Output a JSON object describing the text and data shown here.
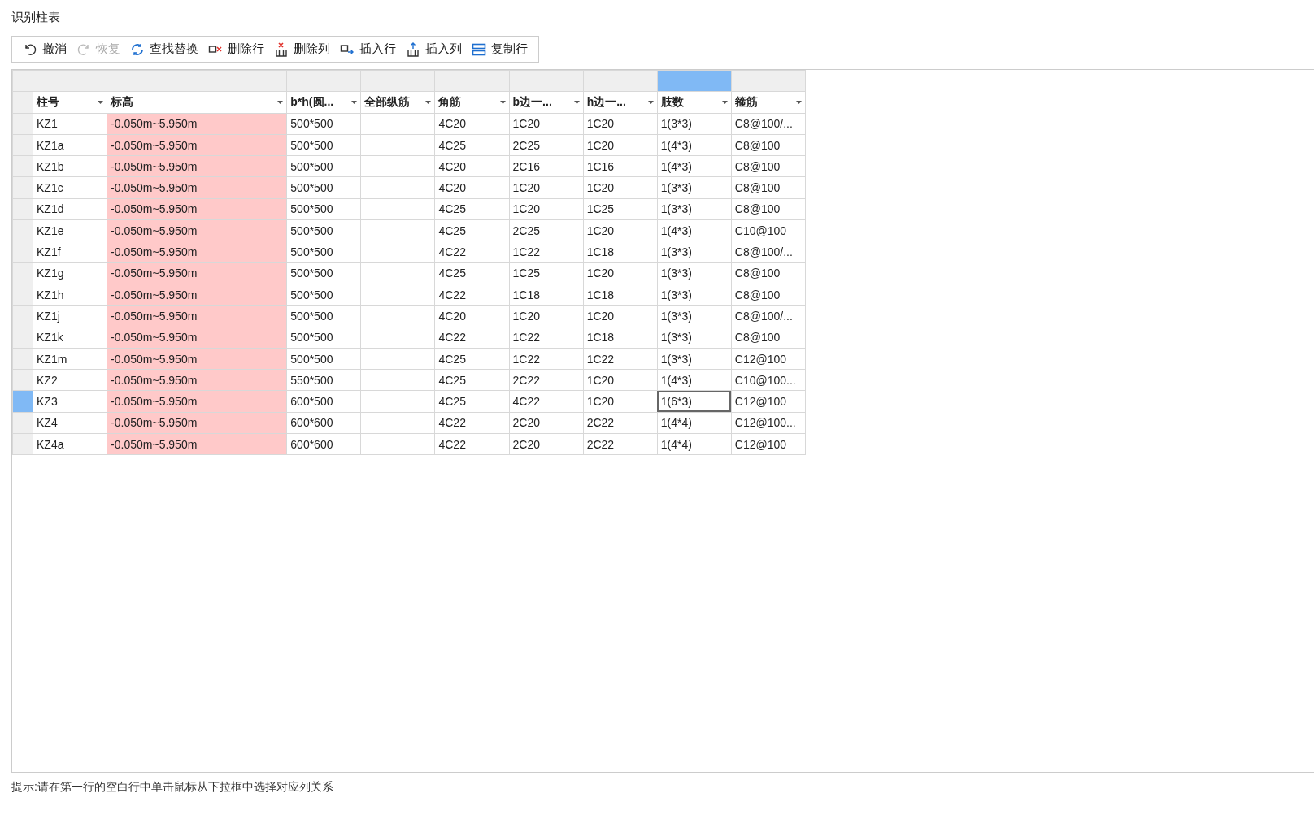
{
  "window": {
    "title": "识别柱表"
  },
  "toolbar": [
    {
      "kind": "undo",
      "label": "撤消",
      "disabled": false
    },
    {
      "kind": "redo",
      "label": "恢复",
      "disabled": true
    },
    {
      "kind": "find",
      "label": "查找替换",
      "disabled": false
    },
    {
      "kind": "delrow",
      "label": "删除行",
      "disabled": false
    },
    {
      "kind": "delcol",
      "label": "删除列",
      "disabled": false
    },
    {
      "kind": "insrow",
      "label": "插入行",
      "disabled": false
    },
    {
      "kind": "inscol",
      "label": "插入列",
      "disabled": false
    },
    {
      "kind": "copyrow",
      "label": "复制行",
      "disabled": false
    }
  ],
  "table": {
    "columns": [
      {
        "label": "柱号",
        "selected": false,
        "flagged": false
      },
      {
        "label": "标高",
        "selected": false,
        "flagged": true
      },
      {
        "label": "b*h(圆...",
        "selected": false,
        "flagged": false
      },
      {
        "label": "全部纵筋",
        "selected": false,
        "flagged": false
      },
      {
        "label": "角筋",
        "selected": false,
        "flagged": false
      },
      {
        "label": "b边一...",
        "selected": false,
        "flagged": false
      },
      {
        "label": "h边一...",
        "selected": false,
        "flagged": false
      },
      {
        "label": "肢数",
        "selected": true,
        "flagged": false
      },
      {
        "label": "箍筋",
        "selected": false,
        "flagged": false
      }
    ],
    "rows": [
      {
        "selected": false,
        "cells": [
          "KZ1",
          "-0.050m~5.950m",
          "500*500",
          "",
          "4C20",
          "1C20",
          "1C20",
          "1(3*3)",
          "C8@100/..."
        ]
      },
      {
        "selected": false,
        "cells": [
          "KZ1a",
          "-0.050m~5.950m",
          "500*500",
          "",
          "4C25",
          "2C25",
          "1C20",
          "1(4*3)",
          "C8@100"
        ]
      },
      {
        "selected": false,
        "cells": [
          "KZ1b",
          "-0.050m~5.950m",
          "500*500",
          "",
          "4C20",
          "2C16",
          "1C16",
          "1(4*3)",
          "C8@100"
        ]
      },
      {
        "selected": false,
        "cells": [
          "KZ1c",
          "-0.050m~5.950m",
          "500*500",
          "",
          "4C20",
          "1C20",
          "1C20",
          "1(3*3)",
          "C8@100"
        ]
      },
      {
        "selected": false,
        "cells": [
          "KZ1d",
          "-0.050m~5.950m",
          "500*500",
          "",
          "4C25",
          "1C20",
          "1C25",
          "1(3*3)",
          "C8@100"
        ]
      },
      {
        "selected": false,
        "cells": [
          "KZ1e",
          "-0.050m~5.950m",
          "500*500",
          "",
          "4C25",
          "2C25",
          "1C20",
          "1(4*3)",
          "C10@100"
        ]
      },
      {
        "selected": false,
        "cells": [
          "KZ1f",
          "-0.050m~5.950m",
          "500*500",
          "",
          "4C22",
          "1C22",
          "1C18",
          "1(3*3)",
          "C8@100/..."
        ]
      },
      {
        "selected": false,
        "cells": [
          "KZ1g",
          "-0.050m~5.950m",
          "500*500",
          "",
          "4C25",
          "1C25",
          "1C20",
          "1(3*3)",
          "C8@100"
        ]
      },
      {
        "selected": false,
        "cells": [
          "KZ1h",
          "-0.050m~5.950m",
          "500*500",
          "",
          "4C22",
          "1C18",
          "1C18",
          "1(3*3)",
          "C8@100"
        ]
      },
      {
        "selected": false,
        "cells": [
          "KZ1j",
          "-0.050m~5.950m",
          "500*500",
          "",
          "4C20",
          "1C20",
          "1C20",
          "1(3*3)",
          "C8@100/..."
        ]
      },
      {
        "selected": false,
        "cells": [
          "KZ1k",
          "-0.050m~5.950m",
          "500*500",
          "",
          "4C22",
          "1C22",
          "1C18",
          "1(3*3)",
          "C8@100"
        ]
      },
      {
        "selected": false,
        "cells": [
          "KZ1m",
          "-0.050m~5.950m",
          "500*500",
          "",
          "4C25",
          "1C22",
          "1C22",
          "1(3*3)",
          "C12@100"
        ]
      },
      {
        "selected": false,
        "cells": [
          "KZ2",
          "-0.050m~5.950m",
          "550*500",
          "",
          "4C25",
          "2C22",
          "1C20",
          "1(4*3)",
          "C10@100..."
        ]
      },
      {
        "selected": true,
        "cells": [
          "KZ3",
          "-0.050m~5.950m",
          "600*500",
          "",
          "4C25",
          "4C22",
          "1C20",
          "1(6*3)",
          "C12@100"
        ]
      },
      {
        "selected": false,
        "cells": [
          "KZ4",
          "-0.050m~5.950m",
          "600*600",
          "",
          "4C22",
          "2C20",
          "2C22",
          "1(4*4)",
          "C12@100..."
        ]
      },
      {
        "selected": false,
        "cells": [
          "KZ4a",
          "-0.050m~5.950m",
          "600*600",
          "",
          "4C22",
          "2C20",
          "2C22",
          "1(4*4)",
          "C12@100"
        ]
      }
    ]
  },
  "hint": "提示:请在第一行的空白行中单击鼠标从下拉框中选择对应列关系"
}
